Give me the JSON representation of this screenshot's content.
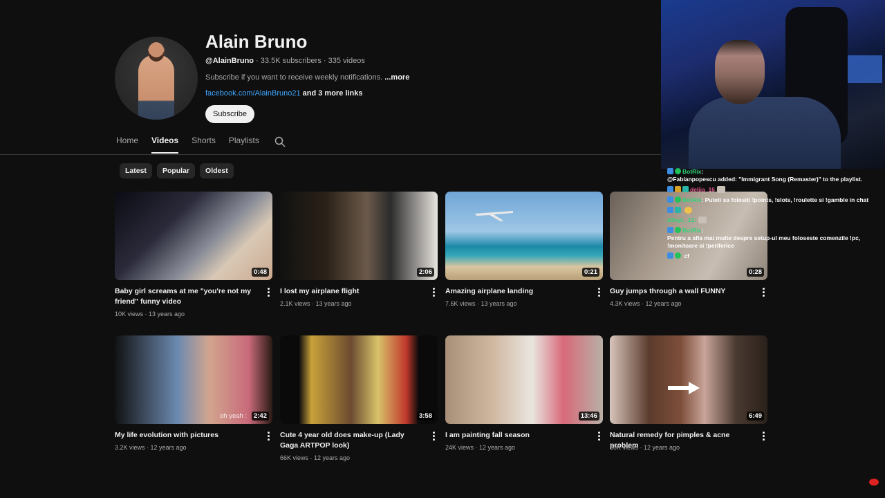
{
  "channel": {
    "name": "Alain Bruno",
    "handle": "@AlainBruno",
    "stats": " · 33.5K subscribers · 335 videos",
    "description": "Subscribe if you want to receive weekly notifications.",
    "more_label": "...more",
    "link": "facebook.com/AlainBruno21",
    "more_links": " and 3 more links",
    "subscribe_label": "Subscribe"
  },
  "tabs": [
    {
      "label": "Home",
      "active": false
    },
    {
      "label": "Videos",
      "active": true
    },
    {
      "label": "Shorts",
      "active": false
    },
    {
      "label": "Playlists",
      "active": false
    }
  ],
  "chips": [
    "Latest",
    "Popular",
    "Oldest"
  ],
  "videos": [
    {
      "title": "Baby girl screams at me \"you're not my friend\" funny video",
      "duration": "0:48",
      "views": "10K views",
      "age": "13 years ago"
    },
    {
      "title": "I lost my airplane flight",
      "duration": "2:06",
      "views": "2.1K views",
      "age": "13 years ago"
    },
    {
      "title": "Amazing airplane landing",
      "duration": "0:21",
      "views": "7.6K views",
      "age": "13 years ago"
    },
    {
      "title": "Guy jumps through a wall FUNNY",
      "duration": "0:28",
      "views": "4.3K views",
      "age": "12 years ago"
    },
    {
      "title": "My life evolution with pictures",
      "duration": "2:42",
      "views": "3.2K views",
      "age": "12 years ago",
      "overlay": "oh yeah :"
    },
    {
      "title": "Cute 4 year old does make-up (Lady Gaga ARTPOP look)",
      "duration": "3:58",
      "views": "66K views",
      "age": "12 years ago"
    },
    {
      "title": "I am painting fall season",
      "duration": "13:46",
      "views": "24K views",
      "age": "12 years ago"
    },
    {
      "title": "Natural remedy for pimples & acne problem",
      "duration": "6:49",
      "views": "50K views",
      "age": "12 years ago"
    }
  ],
  "chat": [
    {
      "user": "BotRix",
      "message": "@Fabianpopescu added: \"Immigrant Song (Remaster)\" to the playlist."
    },
    {
      "user": "deliia_16",
      "message": ""
    },
    {
      "user": "BotRix",
      "message": "Puteti sa folositi !points, !slots, !roulette si !gamble in chat"
    },
    {
      "user": "",
      "message": ""
    },
    {
      "user": "d3nyL_12:",
      "message": ""
    },
    {
      "user": "BotRix",
      "message": "Pentru a afla mai multe despre setup-ul meu foloseste comenzile !pc, !monitoare si !periferice"
    },
    {
      "user": "",
      "message": "cf"
    }
  ],
  "icons": {
    "search": "search-icon",
    "more": "kebab-menu-icon"
  },
  "colors": {
    "background": "#0f0f0f",
    "link": "#3ea6ff",
    "chat_bot": "#34d27a"
  }
}
